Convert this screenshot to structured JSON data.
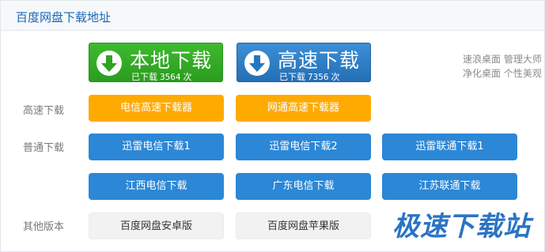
{
  "header": {
    "title": "百度网盘下载地址"
  },
  "primary": {
    "local": {
      "title": "本地下载",
      "count_prefix": "已下载",
      "count": "3564",
      "count_unit": "次",
      "icon": "download-arrow-icon",
      "color": "#33a825"
    },
    "fast": {
      "title": "高速下载",
      "count_prefix": "已下载",
      "count": "7356",
      "count_unit": "次",
      "icon": "download-arrow-icon",
      "color": "#2a7cc7"
    }
  },
  "side_links": {
    "line1": "速浪桌面 管理大师",
    "line2": "净化桌面 个性美观"
  },
  "rows": {
    "high_speed": {
      "label": "高速下载",
      "buttons": [
        "电信高速下载器",
        "网通高速下载器"
      ]
    },
    "normal": {
      "label": "普通下载",
      "buttons": [
        "迅雷电信下载1",
        "迅雷电信下载2",
        "迅雷联通下载1",
        "江西电信下载",
        "广东电信下载",
        "江苏联通下载"
      ]
    },
    "other": {
      "label": "其他版本",
      "buttons": [
        "百度网盘安卓版",
        "百度网盘苹果版"
      ]
    }
  },
  "watermark": "极速下载站",
  "colors": {
    "orange": "#ffaa00",
    "blue": "#2c87d6",
    "title_blue": "#1a66b8"
  }
}
